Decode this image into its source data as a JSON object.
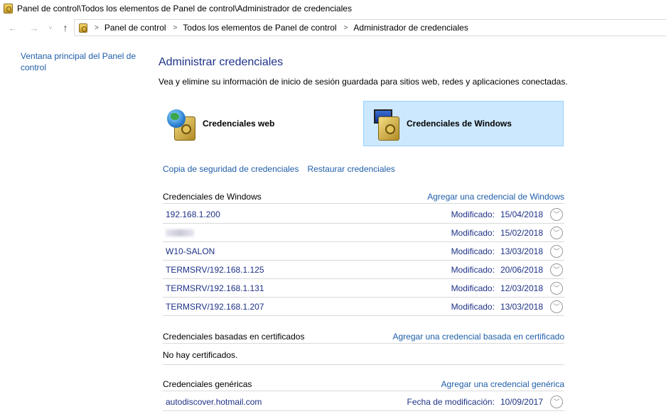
{
  "window": {
    "title": "Panel de control\\Todos los elementos de Panel de control\\Administrador de credenciales"
  },
  "nav": {
    "back_icon": "←",
    "forward_icon": "→",
    "recent_icon": "˅",
    "up_icon": "↑"
  },
  "breadcrumb": {
    "separator": ">",
    "items": [
      "Panel de control",
      "Todos los elementos de Panel de control",
      "Administrador de credenciales"
    ]
  },
  "sidebar": {
    "link": "Ventana principal del Panel de control"
  },
  "main": {
    "title": "Administrar credenciales",
    "description": "Vea y elimine su información de inicio de sesión guardada para sitios web, redes y aplicaciones conectadas.",
    "tiles": {
      "web": "Credenciales web",
      "windows": "Credenciales de Windows",
      "selected": "windows"
    },
    "actions": {
      "backup": "Copia de seguridad de credenciales",
      "restore": "Restaurar credenciales"
    }
  },
  "windows_credentials": {
    "header": "Credenciales de Windows",
    "add_link": "Agregar una credencial de Windows",
    "modified_label": "Modificado:",
    "items": [
      {
        "name": "192.168.1.200",
        "date": "15/04/2018"
      },
      {
        "name": "",
        "date": "15/02/2018"
      },
      {
        "name": "W10-SALON",
        "date": "13/03/2018"
      },
      {
        "name": "TERMSRV/192.168.1.125",
        "date": "20/06/2018"
      },
      {
        "name": "TERMSRV/192.168.1.131",
        "date": "12/03/2018"
      },
      {
        "name": "TERMSRV/192.168.1.207",
        "date": "13/03/2018"
      }
    ]
  },
  "certificate_credentials": {
    "header": "Credenciales basadas en certificados",
    "add_link": "Agregar una credencial basada en certificado",
    "empty_text": "No hay certificados."
  },
  "generic_credentials": {
    "header": "Credenciales genéricas",
    "add_link": "Agregar una credencial genérica",
    "modified_label": "Fecha de modificación:",
    "items": [
      {
        "name": "autodiscover.hotmail.com",
        "date": "10/09/2017"
      }
    ]
  },
  "expand_icon": "﹀",
  "colors": {
    "link": "#1f5ea8",
    "title": "#1e3287",
    "selected_tile_bg": "#cce8ff",
    "selected_tile_border": "#99d1ff"
  }
}
